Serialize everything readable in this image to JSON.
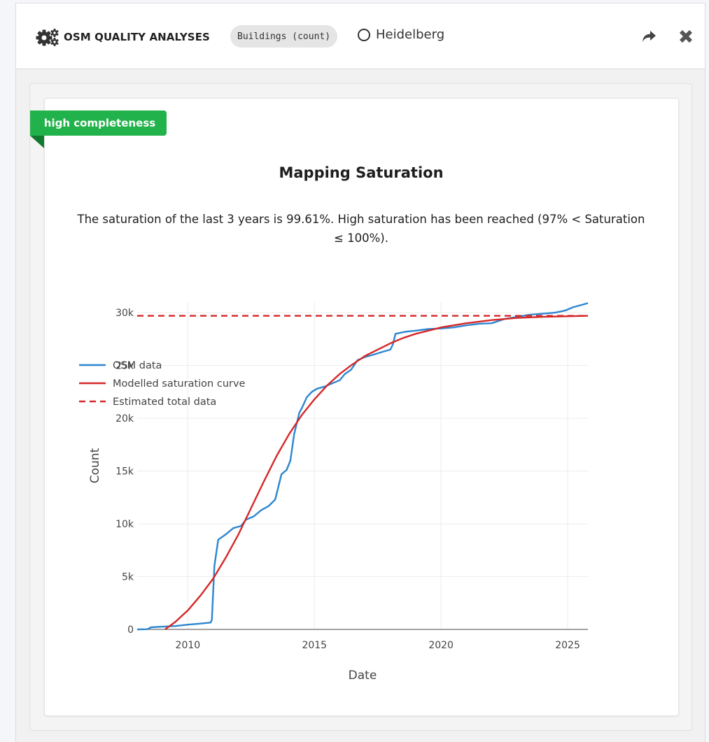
{
  "header": {
    "title": "OSM QUALITY ANALYSES",
    "topic": "Buildings (count)",
    "region": "Heidelberg"
  },
  "card": {
    "badge": "high completeness",
    "title": "Mapping Saturation",
    "description": "The saturation of the last 3 years is 99.61%. High saturation has been reached (97% < Saturation ≤ 100%)."
  },
  "colors": {
    "osm_line": "#2c86d0",
    "model_line": "#d62728",
    "badge_green": "#21b24b"
  },
  "chart_data": {
    "type": "line",
    "xlabel": "Date",
    "ylabel": "Count",
    "xlim": [
      2008,
      2025.8
    ],
    "ylim": [
      0,
      31000
    ],
    "x_ticks": [
      2010,
      2015,
      2020,
      2025
    ],
    "y_ticks": [
      0,
      5000,
      10000,
      15000,
      20000,
      25000,
      30000
    ],
    "y_tick_labels": [
      "0",
      "5k",
      "10k",
      "15k",
      "20k",
      "25k",
      "30k"
    ],
    "grid": true,
    "legend_position": "top-left",
    "series": [
      {
        "name": "OSM data",
        "style": "solid",
        "color": "#2c86d0",
        "points": [
          [
            2008.0,
            0
          ],
          [
            2008.4,
            20
          ],
          [
            2008.55,
            200
          ],
          [
            2009.0,
            260
          ],
          [
            2009.5,
            320
          ],
          [
            2010.0,
            450
          ],
          [
            2010.5,
            550
          ],
          [
            2010.9,
            650
          ],
          [
            2010.95,
            900
          ],
          [
            2011.05,
            6000
          ],
          [
            2011.2,
            8500
          ],
          [
            2011.5,
            9000
          ],
          [
            2011.8,
            9600
          ],
          [
            2012.1,
            9800
          ],
          [
            2012.3,
            10400
          ],
          [
            2012.6,
            10700
          ],
          [
            2012.9,
            11300
          ],
          [
            2013.2,
            11700
          ],
          [
            2013.45,
            12300
          ],
          [
            2013.7,
            14700
          ],
          [
            2013.9,
            15100
          ],
          [
            2014.05,
            16000
          ],
          [
            2014.2,
            18500
          ],
          [
            2014.4,
            20500
          ],
          [
            2014.55,
            21200
          ],
          [
            2014.7,
            22000
          ],
          [
            2014.9,
            22500
          ],
          [
            2015.1,
            22800
          ],
          [
            2015.4,
            23000
          ],
          [
            2015.7,
            23300
          ],
          [
            2016.0,
            23600
          ],
          [
            2016.2,
            24200
          ],
          [
            2016.45,
            24600
          ],
          [
            2016.7,
            25500
          ],
          [
            2017.0,
            25800
          ],
          [
            2017.3,
            26000
          ],
          [
            2017.7,
            26300
          ],
          [
            2018.0,
            26500
          ],
          [
            2018.1,
            27000
          ],
          [
            2018.2,
            28000
          ],
          [
            2018.6,
            28200
          ],
          [
            2019.0,
            28300
          ],
          [
            2019.5,
            28450
          ],
          [
            2020.0,
            28500
          ],
          [
            2020.5,
            28600
          ],
          [
            2021.0,
            28800
          ],
          [
            2021.5,
            28950
          ],
          [
            2022.0,
            29000
          ],
          [
            2022.5,
            29400
          ],
          [
            2023.0,
            29600
          ],
          [
            2023.5,
            29800
          ],
          [
            2024.0,
            29900
          ],
          [
            2024.5,
            30000
          ],
          [
            2024.9,
            30200
          ],
          [
            2025.2,
            30500
          ],
          [
            2025.5,
            30700
          ],
          [
            2025.8,
            30900
          ]
        ]
      },
      {
        "name": "Modelled saturation curve",
        "style": "solid",
        "color": "#d62728",
        "points": [
          [
            2009.1,
            0
          ],
          [
            2009.5,
            700
          ],
          [
            2010.0,
            1800
          ],
          [
            2010.5,
            3200
          ],
          [
            2011.0,
            4800
          ],
          [
            2011.5,
            6800
          ],
          [
            2012.0,
            9000
          ],
          [
            2012.5,
            11500
          ],
          [
            2013.0,
            14000
          ],
          [
            2013.5,
            16400
          ],
          [
            2014.0,
            18500
          ],
          [
            2014.5,
            20300
          ],
          [
            2015.0,
            21800
          ],
          [
            2015.5,
            23100
          ],
          [
            2016.0,
            24200
          ],
          [
            2016.5,
            25100
          ],
          [
            2017.0,
            25900
          ],
          [
            2017.5,
            26500
          ],
          [
            2018.0,
            27100
          ],
          [
            2018.5,
            27600
          ],
          [
            2019.0,
            28000
          ],
          [
            2019.5,
            28300
          ],
          [
            2020.0,
            28600
          ],
          [
            2021.0,
            29000
          ],
          [
            2022.0,
            29300
          ],
          [
            2023.0,
            29500
          ],
          [
            2024.0,
            29600
          ],
          [
            2025.8,
            29700
          ]
        ]
      },
      {
        "name": "Estimated total data",
        "style": "dashed",
        "color": "#d62728",
        "points": [
          [
            2008.0,
            29700
          ],
          [
            2025.8,
            29700
          ]
        ]
      }
    ]
  }
}
